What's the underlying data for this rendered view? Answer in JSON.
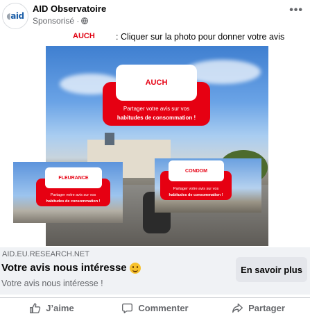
{
  "post": {
    "avatar_text": "aid",
    "page_name": "AID Observatoire",
    "sponsored_label": "Sponsorisé ·",
    "more_label": "•••"
  },
  "caption": {
    "brand": "AUCH",
    "text": ": Cliquer sur la photo pour donner votre avis"
  },
  "media": {
    "main_card": {
      "brand": "AUCH",
      "line1": "Partager votre avis sur vos",
      "line2": "habitudes de consommation !"
    },
    "left_card": {
      "brand": "FLEURANCE",
      "line1": "Partager votre avis sur vos",
      "line2": "habitudes de consommation !"
    },
    "right_card": {
      "brand": "CONDOM",
      "line1": "Partager votre avis sur vos",
      "line2": "habitudes de consommation !"
    }
  },
  "link": {
    "domain": "AID.EU.RESEARCH.NET",
    "headline": "Votre avis nous intéresse",
    "description": "Votre avis nous intéresse !",
    "cta_label": "En savoir plus"
  },
  "actions": {
    "like": "J’aime",
    "comment": "Commenter",
    "share": "Partager"
  },
  "colors": {
    "brand_red": "#e60012",
    "text_secondary": "#65676b",
    "link_bar_bg": "#f0f2f5"
  }
}
